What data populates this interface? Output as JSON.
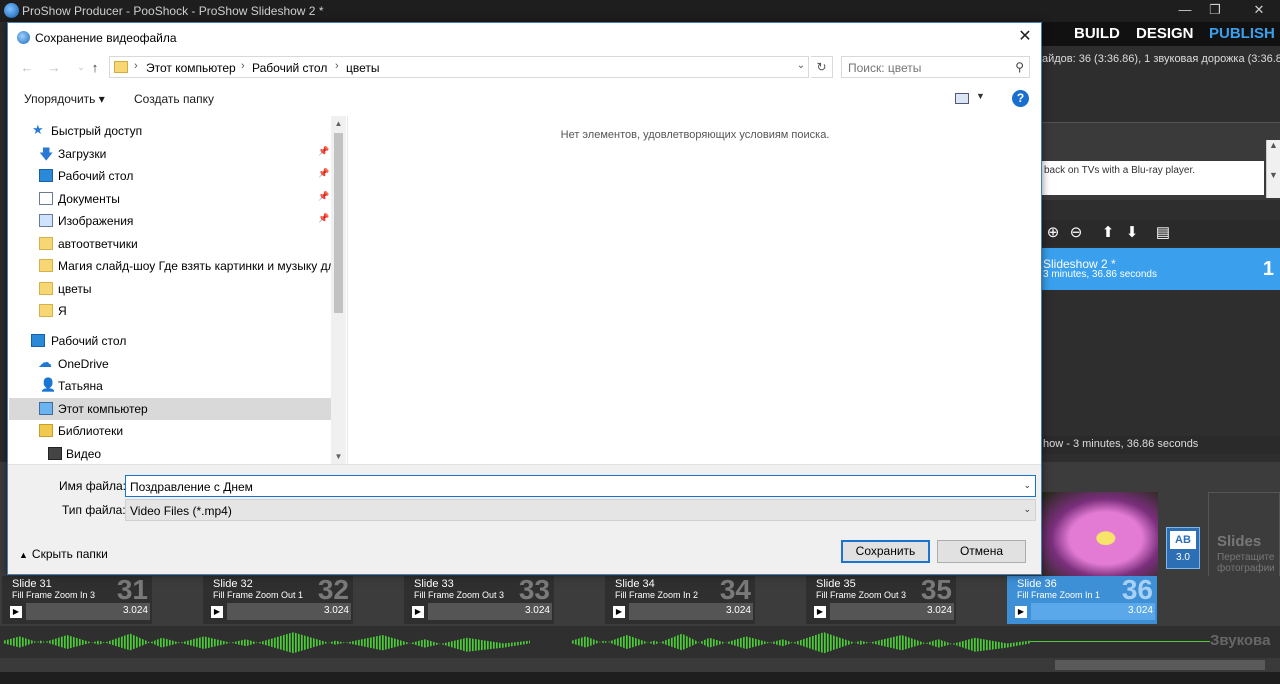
{
  "app": {
    "title": "ProShow Producer - PooShock - ProShow Slideshow 2 *",
    "tabs": [
      "BUILD",
      "DESIGN",
      "PUBLISH"
    ],
    "info_line": "айдов: 36 (3:36.86), 1 звуковая дорожка (3:36.89)",
    "panel_desc": "back on TVs with a Blu-ray player.",
    "slideshow_name": "Slideshow 2 *",
    "slideshow_duration": "3 minutes, 36.86 seconds",
    "slideshow_number": "1",
    "status_line": "how - 3 minutes, 36.86 seconds",
    "ab_value": "3.0",
    "ab_label": "AB",
    "slides_drop_title": "Slides",
    "slides_drop_hint": "Перетащите фотографии",
    "audio_label": "Звукова",
    "accent_color": "#3d8fd6",
    "slides": [
      {
        "name": "Slide 31",
        "effect": "Fill Frame Zoom In 3",
        "number": "31",
        "time": "3.024"
      },
      {
        "name": "Slide 32",
        "effect": "Fill Frame Zoom Out 1",
        "number": "32",
        "time": "3.024"
      },
      {
        "name": "Slide 33",
        "effect": "Fill Frame Zoom Out 3",
        "number": "33",
        "time": "3.024"
      },
      {
        "name": "Slide 34",
        "effect": "Fill Frame Zoom In 2",
        "number": "34",
        "time": "3.024"
      },
      {
        "name": "Slide 35",
        "effect": "Fill Frame Zoom Out 3",
        "number": "35",
        "time": "3.024"
      },
      {
        "name": "Slide 36",
        "effect": "Fill Frame Zoom In 1",
        "number": "36",
        "time": "3.024"
      }
    ]
  },
  "dialog": {
    "title": "Сохранение видеофайла",
    "breadcrumbs": [
      "Этот компьютер",
      "Рабочий стол",
      "цветы"
    ],
    "search_placeholder": "Поиск: цветы",
    "organize_label": "Упорядочить ▾",
    "new_folder_label": "Создать папку",
    "empty_message": "Нет элементов, удовлетворяющих условиям поиска.",
    "nav_items": [
      {
        "label": "Быстрый доступ",
        "icon": "star-icon",
        "pinned": false
      },
      {
        "label": "Загрузки",
        "icon": "downloads-icon",
        "pinned": true
      },
      {
        "label": "Рабочий стол",
        "icon": "desktop-icon",
        "pinned": true
      },
      {
        "label": "Документы",
        "icon": "documents-icon",
        "pinned": true
      },
      {
        "label": "Изображения",
        "icon": "pictures-icon",
        "pinned": true
      },
      {
        "label": "автоответчики",
        "icon": "folder-icon",
        "pinned": false
      },
      {
        "label": "Магия слайд-шоу Где взять картинки и музыку для с",
        "icon": "folder-icon",
        "pinned": false
      },
      {
        "label": "цветы",
        "icon": "folder-icon",
        "pinned": false
      },
      {
        "label": "Я",
        "icon": "folder-icon",
        "pinned": false
      },
      {
        "label": "Рабочий стол",
        "icon": "desktop-icon",
        "pinned": false
      },
      {
        "label": "OneDrive",
        "icon": "onedrive-icon",
        "pinned": false
      },
      {
        "label": "Татьяна",
        "icon": "user-icon",
        "pinned": false
      },
      {
        "label": "Этот компьютер",
        "icon": "computer-icon",
        "pinned": false,
        "selected": true
      },
      {
        "label": "Библиотеки",
        "icon": "libraries-icon",
        "pinned": false
      },
      {
        "label": "Видео",
        "icon": "video-icon",
        "pinned": false
      }
    ],
    "filename_label": "Имя файла:",
    "filename_value": "Поздравление с Днем",
    "filetype_label": "Тип файла:",
    "filetype_value": "Video Files (*.mp4)",
    "hide_folders_label": "Скрыть папки",
    "save_label": "Сохранить",
    "cancel_label": "Отмена"
  }
}
